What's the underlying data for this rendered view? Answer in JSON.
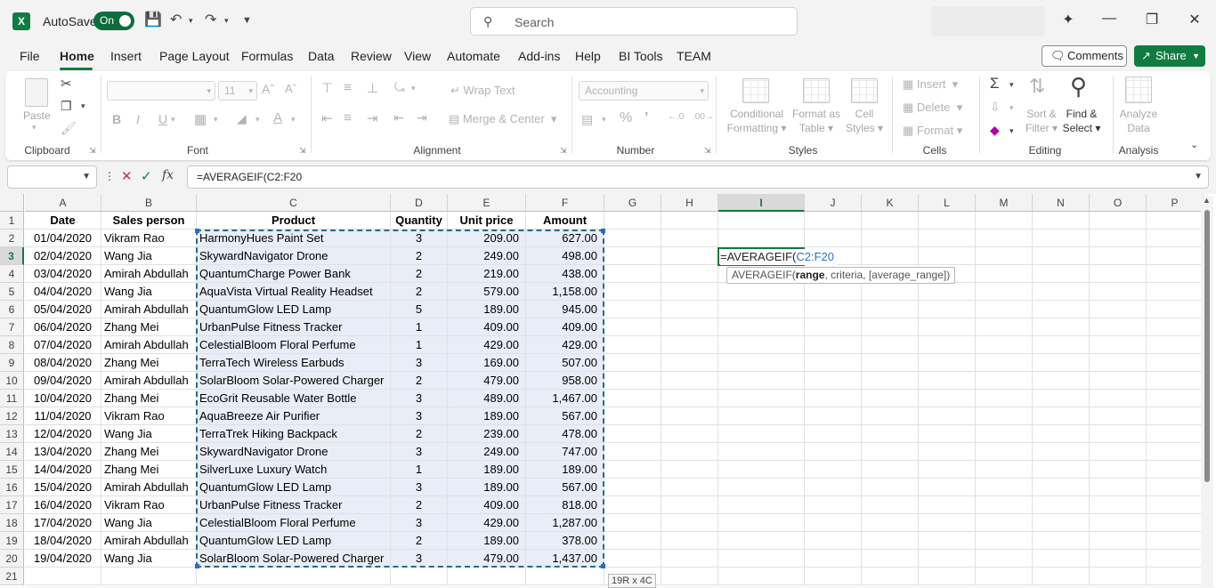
{
  "titlebar": {
    "app_icon": "X",
    "autosave_label": "AutoSave",
    "autosave_state": "On",
    "search_placeholder": "Search"
  },
  "tabs": [
    "File",
    "Home",
    "Insert",
    "Page Layout",
    "Formulas",
    "Data",
    "Review",
    "View",
    "Automate",
    "Add-ins",
    "Help",
    "BI Tools",
    "TEAM"
  ],
  "actions": {
    "comments": "Comments",
    "share": "Share"
  },
  "ribbon": {
    "clipboard": {
      "label": "Clipboard",
      "paste": "Paste"
    },
    "font": {
      "label": "Font",
      "size": "11"
    },
    "alignment": {
      "label": "Alignment",
      "wrap": "Wrap Text",
      "merge": "Merge & Center"
    },
    "number": {
      "label": "Number",
      "format": "Accounting"
    },
    "styles": {
      "label": "Styles",
      "cond1": "Conditional",
      "cond2": "Formatting",
      "fmt1": "Format as",
      "fmt2": "Table",
      "cell1": "Cell",
      "cell2": "Styles"
    },
    "cells": {
      "label": "Cells",
      "insert": "Insert",
      "delete": "Delete",
      "format": "Format"
    },
    "editing": {
      "label": "Editing",
      "sort1": "Sort &",
      "sort2": "Filter",
      "find1": "Find &",
      "find2": "Select"
    },
    "analysis": {
      "label": "Analysis",
      "analyze1": "Analyze",
      "analyze2": "Data"
    }
  },
  "formula_bar": {
    "formula": "=AVERAGEIF(C2:F20"
  },
  "columns": [
    "A",
    "B",
    "C",
    "D",
    "E",
    "F",
    "G",
    "H",
    "I",
    "J",
    "K",
    "L",
    "M",
    "N",
    "O",
    "P"
  ],
  "headers": [
    "Date",
    "Sales person",
    "Product",
    "Quantity",
    "Unit price",
    "Amount"
  ],
  "rows": [
    [
      "01/04/2020",
      "Vikram Rao",
      "HarmonyHues Paint Set",
      "3",
      "209.00",
      "627.00"
    ],
    [
      "02/04/2020",
      "Wang Jia",
      "SkywardNavigator Drone",
      "2",
      "249.00",
      "498.00"
    ],
    [
      "03/04/2020",
      "Amirah Abdullah",
      "QuantumCharge Power Bank",
      "2",
      "219.00",
      "438.00"
    ],
    [
      "04/04/2020",
      "Wang Jia",
      "AquaVista Virtual Reality Headset",
      "2",
      "579.00",
      "1,158.00"
    ],
    [
      "05/04/2020",
      "Amirah Abdullah",
      "QuantumGlow LED Lamp",
      "5",
      "189.00",
      "945.00"
    ],
    [
      "06/04/2020",
      "Zhang Mei",
      "UrbanPulse Fitness Tracker",
      "1",
      "409.00",
      "409.00"
    ],
    [
      "07/04/2020",
      "Amirah Abdullah",
      "CelestialBloom Floral Perfume",
      "1",
      "429.00",
      "429.00"
    ],
    [
      "08/04/2020",
      "Zhang Mei",
      "TerraTech Wireless Earbuds",
      "3",
      "169.00",
      "507.00"
    ],
    [
      "09/04/2020",
      "Amirah Abdullah",
      "SolarBloom Solar-Powered Charger",
      "2",
      "479.00",
      "958.00"
    ],
    [
      "10/04/2020",
      "Zhang Mei",
      "EcoGrit Reusable Water Bottle",
      "3",
      "489.00",
      "1,467.00"
    ],
    [
      "11/04/2020",
      "Vikram Rao",
      "AquaBreeze Air Purifier",
      "3",
      "189.00",
      "567.00"
    ],
    [
      "12/04/2020",
      "Wang Jia",
      "TerraTrek Hiking Backpack",
      "2",
      "239.00",
      "478.00"
    ],
    [
      "13/04/2020",
      "Zhang Mei",
      "SkywardNavigator Drone",
      "3",
      "249.00",
      "747.00"
    ],
    [
      "14/04/2020",
      "Zhang Mei",
      "SilverLuxe Luxury Watch",
      "1",
      "189.00",
      "189.00"
    ],
    [
      "15/04/2020",
      "Amirah Abdullah",
      "QuantumGlow LED Lamp",
      "3",
      "189.00",
      "567.00"
    ],
    [
      "16/04/2020",
      "Vikram Rao",
      "UrbanPulse Fitness Tracker",
      "2",
      "409.00",
      "818.00"
    ],
    [
      "17/04/2020",
      "Wang Jia",
      "CelestialBloom Floral Perfume",
      "3",
      "429.00",
      "1,287.00"
    ],
    [
      "18/04/2020",
      "Amirah Abdullah",
      "QuantumGlow LED Lamp",
      "2",
      "189.00",
      "378.00"
    ],
    [
      "19/04/2020",
      "Wang Jia",
      "SolarBloom Solar-Powered Charger",
      "3",
      "479.00",
      "1,437.00"
    ]
  ],
  "active_cell": {
    "prefix": "=AVERAGEIF(",
    "ref": "C2:F20"
  },
  "tooltip": {
    "fn": "AVERAGEIF(",
    "arg_bold": "range",
    "rest": ", criteria, [average_range])"
  },
  "range_size_tip": "19R x 4C"
}
